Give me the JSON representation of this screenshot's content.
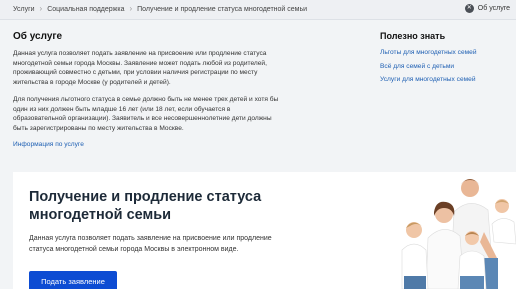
{
  "breadcrumbs": [
    "Услуги",
    "Социальная поддержка",
    "Получение и продление статуса многодетной семьи"
  ],
  "about_toggle": {
    "label": "Об услуге",
    "icon": "close-icon"
  },
  "about": {
    "title": "Об услуге",
    "paragraph1": "Данная услуга позволяет подать заявление на присвоение или продление статуса многодетной семьи города Москвы. Заявление может подать любой из родителей, проживающий совместно с детьми, при условии наличия регистрации по месту жительства в городе Москве (у родителей и детей).",
    "paragraph2": "Для получения льготного статуса в семье должно быть не менее трех детей и хотя бы один из них должен быть младше 16 лет (или 18 лет, если обучается в образовательной организации). Заявитель и все несовершеннолетние дети должны быть зарегистрированы по месту жительства в Москве.",
    "more_link": "Информация по услуге"
  },
  "useful": {
    "title": "Полезно знать",
    "links": [
      "Льготы для многодетных семей",
      "Всё для семей с детьми",
      "Услуги для многодетных семей"
    ]
  },
  "hero": {
    "title": "Получение и продление статуса многодетной семьи",
    "description": "Данная услуга позволяет подать заявление на присвоение или продление статуса многодетной семьи города Москвы в электронном виде.",
    "button": "Подать заявление"
  },
  "colors": {
    "link": "#1e5fb3",
    "button": "#0d4cd3",
    "page_bg": "#f2f4f6"
  }
}
